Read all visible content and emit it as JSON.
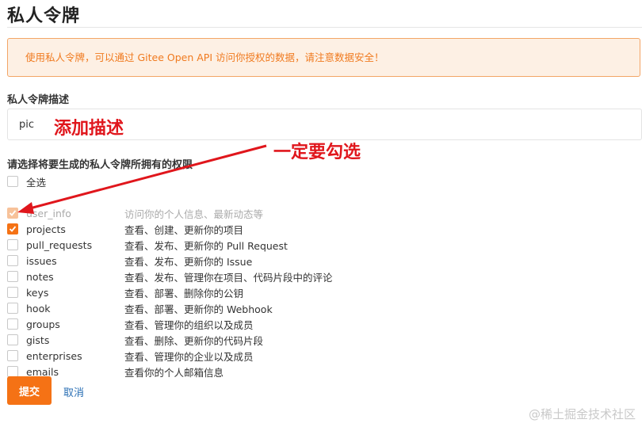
{
  "page": {
    "title": "私人令牌",
    "alert_text": "使用私人令牌，可以通过 Gitee Open API 访问你授权的数据，请注意数据安全！"
  },
  "description": {
    "label": "私人令牌描述",
    "value": "pic"
  },
  "permissions": {
    "label": "请选择将要生成的私人令牌所拥有的权限",
    "select_all_label": "全选",
    "items": [
      {
        "name": "user_info",
        "desc": "访问你的个人信息、最新动态等",
        "checked": true,
        "disabled": true
      },
      {
        "name": "projects",
        "desc": "查看、创建、更新你的项目",
        "checked": true,
        "disabled": false
      },
      {
        "name": "pull_requests",
        "desc": "查看、发布、更新你的 Pull Request",
        "checked": false,
        "disabled": false
      },
      {
        "name": "issues",
        "desc": "查看、发布、更新你的 Issue",
        "checked": false,
        "disabled": false
      },
      {
        "name": "notes",
        "desc": "查看、发布、管理你在项目、代码片段中的评论",
        "checked": false,
        "disabled": false
      },
      {
        "name": "keys",
        "desc": "查看、部署、删除你的公钥",
        "checked": false,
        "disabled": false
      },
      {
        "name": "hook",
        "desc": "查看、部署、更新你的 Webhook",
        "checked": false,
        "disabled": false
      },
      {
        "name": "groups",
        "desc": "查看、管理你的组织以及成员",
        "checked": false,
        "disabled": false
      },
      {
        "name": "gists",
        "desc": "查看、删除、更新你的代码片段",
        "checked": false,
        "disabled": false
      },
      {
        "name": "enterprises",
        "desc": "查看、管理你的企业以及成员",
        "checked": false,
        "disabled": false
      },
      {
        "name": "emails",
        "desc": "查看你的个人邮箱信息",
        "checked": false,
        "disabled": false
      }
    ]
  },
  "actions": {
    "submit_label": "提交",
    "cancel_label": "取消"
  },
  "annotations": {
    "description_note": "添加描述",
    "check_note": "一定要勾选",
    "color": "#e0161c"
  },
  "watermark": "@稀土掘金技术社区",
  "colors": {
    "accent": "#f57215",
    "alert_bg": "#fdf0e4",
    "alert_border": "#f3a566",
    "link": "#2a6fb4"
  }
}
